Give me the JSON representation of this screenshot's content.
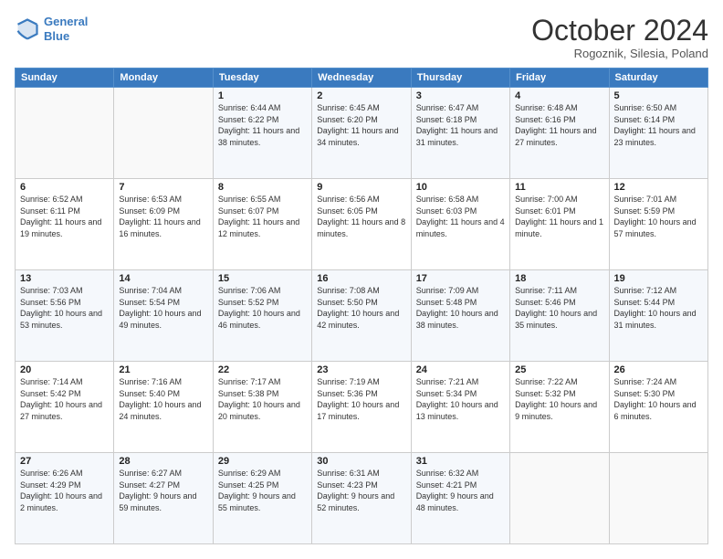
{
  "header": {
    "logo_line1": "General",
    "logo_line2": "Blue",
    "month": "October 2024",
    "location": "Rogoznik, Silesia, Poland"
  },
  "days_of_week": [
    "Sunday",
    "Monday",
    "Tuesday",
    "Wednesday",
    "Thursday",
    "Friday",
    "Saturday"
  ],
  "weeks": [
    [
      {
        "num": "",
        "text": ""
      },
      {
        "num": "",
        "text": ""
      },
      {
        "num": "1",
        "text": "Sunrise: 6:44 AM\nSunset: 6:22 PM\nDaylight: 11 hours and 38 minutes."
      },
      {
        "num": "2",
        "text": "Sunrise: 6:45 AM\nSunset: 6:20 PM\nDaylight: 11 hours and 34 minutes."
      },
      {
        "num": "3",
        "text": "Sunrise: 6:47 AM\nSunset: 6:18 PM\nDaylight: 11 hours and 31 minutes."
      },
      {
        "num": "4",
        "text": "Sunrise: 6:48 AM\nSunset: 6:16 PM\nDaylight: 11 hours and 27 minutes."
      },
      {
        "num": "5",
        "text": "Sunrise: 6:50 AM\nSunset: 6:14 PM\nDaylight: 11 hours and 23 minutes."
      }
    ],
    [
      {
        "num": "6",
        "text": "Sunrise: 6:52 AM\nSunset: 6:11 PM\nDaylight: 11 hours and 19 minutes."
      },
      {
        "num": "7",
        "text": "Sunrise: 6:53 AM\nSunset: 6:09 PM\nDaylight: 11 hours and 16 minutes."
      },
      {
        "num": "8",
        "text": "Sunrise: 6:55 AM\nSunset: 6:07 PM\nDaylight: 11 hours and 12 minutes."
      },
      {
        "num": "9",
        "text": "Sunrise: 6:56 AM\nSunset: 6:05 PM\nDaylight: 11 hours and 8 minutes."
      },
      {
        "num": "10",
        "text": "Sunrise: 6:58 AM\nSunset: 6:03 PM\nDaylight: 11 hours and 4 minutes."
      },
      {
        "num": "11",
        "text": "Sunrise: 7:00 AM\nSunset: 6:01 PM\nDaylight: 11 hours and 1 minute."
      },
      {
        "num": "12",
        "text": "Sunrise: 7:01 AM\nSunset: 5:59 PM\nDaylight: 10 hours and 57 minutes."
      }
    ],
    [
      {
        "num": "13",
        "text": "Sunrise: 7:03 AM\nSunset: 5:56 PM\nDaylight: 10 hours and 53 minutes."
      },
      {
        "num": "14",
        "text": "Sunrise: 7:04 AM\nSunset: 5:54 PM\nDaylight: 10 hours and 49 minutes."
      },
      {
        "num": "15",
        "text": "Sunrise: 7:06 AM\nSunset: 5:52 PM\nDaylight: 10 hours and 46 minutes."
      },
      {
        "num": "16",
        "text": "Sunrise: 7:08 AM\nSunset: 5:50 PM\nDaylight: 10 hours and 42 minutes."
      },
      {
        "num": "17",
        "text": "Sunrise: 7:09 AM\nSunset: 5:48 PM\nDaylight: 10 hours and 38 minutes."
      },
      {
        "num": "18",
        "text": "Sunrise: 7:11 AM\nSunset: 5:46 PM\nDaylight: 10 hours and 35 minutes."
      },
      {
        "num": "19",
        "text": "Sunrise: 7:12 AM\nSunset: 5:44 PM\nDaylight: 10 hours and 31 minutes."
      }
    ],
    [
      {
        "num": "20",
        "text": "Sunrise: 7:14 AM\nSunset: 5:42 PM\nDaylight: 10 hours and 27 minutes."
      },
      {
        "num": "21",
        "text": "Sunrise: 7:16 AM\nSunset: 5:40 PM\nDaylight: 10 hours and 24 minutes."
      },
      {
        "num": "22",
        "text": "Sunrise: 7:17 AM\nSunset: 5:38 PM\nDaylight: 10 hours and 20 minutes."
      },
      {
        "num": "23",
        "text": "Sunrise: 7:19 AM\nSunset: 5:36 PM\nDaylight: 10 hours and 17 minutes."
      },
      {
        "num": "24",
        "text": "Sunrise: 7:21 AM\nSunset: 5:34 PM\nDaylight: 10 hours and 13 minutes."
      },
      {
        "num": "25",
        "text": "Sunrise: 7:22 AM\nSunset: 5:32 PM\nDaylight: 10 hours and 9 minutes."
      },
      {
        "num": "26",
        "text": "Sunrise: 7:24 AM\nSunset: 5:30 PM\nDaylight: 10 hours and 6 minutes."
      }
    ],
    [
      {
        "num": "27",
        "text": "Sunrise: 6:26 AM\nSunset: 4:29 PM\nDaylight: 10 hours and 2 minutes."
      },
      {
        "num": "28",
        "text": "Sunrise: 6:27 AM\nSunset: 4:27 PM\nDaylight: 9 hours and 59 minutes."
      },
      {
        "num": "29",
        "text": "Sunrise: 6:29 AM\nSunset: 4:25 PM\nDaylight: 9 hours and 55 minutes."
      },
      {
        "num": "30",
        "text": "Sunrise: 6:31 AM\nSunset: 4:23 PM\nDaylight: 9 hours and 52 minutes."
      },
      {
        "num": "31",
        "text": "Sunrise: 6:32 AM\nSunset: 4:21 PM\nDaylight: 9 hours and 48 minutes."
      },
      {
        "num": "",
        "text": ""
      },
      {
        "num": "",
        "text": ""
      }
    ]
  ]
}
